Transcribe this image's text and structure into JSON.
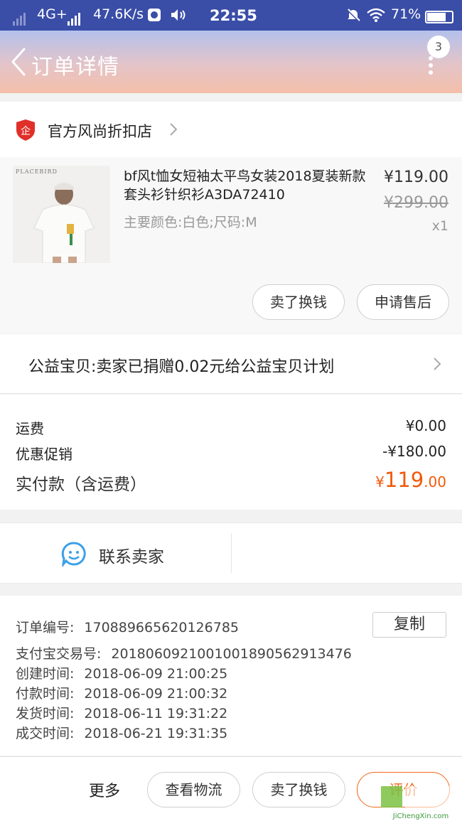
{
  "status_bar": {
    "network": "4G+",
    "speed": "47.6K/s",
    "time": "22:55",
    "battery": "71%"
  },
  "header": {
    "title": "订单详情",
    "badge_count": "3"
  },
  "shop": {
    "name": "官方风尚折扣店",
    "icon_text": "企"
  },
  "product": {
    "image_brand": "PLACEBIRD",
    "title": "bf风t恤女短袖太平鸟女装2018夏装新款套头衫针织衫A3DA72410",
    "spec": "主要颜色:白色;尺码:M",
    "price": "¥119.00",
    "original_price": "¥299.00",
    "quantity": "x1",
    "buttons": [
      "卖了换钱",
      "申请售后"
    ]
  },
  "charity": {
    "text": "公益宝贝:卖家已捐赠0.02元给公益宝贝计划"
  },
  "fees": {
    "shipping_label": "运费",
    "shipping_value": "¥0.00",
    "discount_label": "优惠促销",
    "discount_value": "-¥180.00",
    "total_label": "实付款（含运费）",
    "total_currency": "¥",
    "total_int": "119",
    "total_dec": ".00"
  },
  "contact": {
    "label": "联系卖家"
  },
  "order_info": {
    "copy_label": "复制",
    "lines": [
      {
        "label": "订单编号:",
        "value": "170889665620126785"
      },
      {
        "label": "支付宝交易号:",
        "value": "2018060921001001890562913476"
      },
      {
        "label": "创建时间:",
        "value": "2018-06-09 21:00:25"
      },
      {
        "label": "付款时间:",
        "value": "2018-06-09 21:00:32"
      },
      {
        "label": "发货时间:",
        "value": "2018-06-11 19:31:22"
      },
      {
        "label": "成交时间:",
        "value": "2018-06-21 19:31:35"
      }
    ]
  },
  "bottom_bar": {
    "more": "更多",
    "logistics": "查看物流",
    "resell": "卖了换钱",
    "review": "评价"
  },
  "watermark": {
    "text": "JiChengXin.com"
  },
  "colors": {
    "status_bar": "#3a4da7",
    "accent_orange": "#f05a0a",
    "shop_red": "#e0302a",
    "contact_blue": "#3ca0e8"
  }
}
